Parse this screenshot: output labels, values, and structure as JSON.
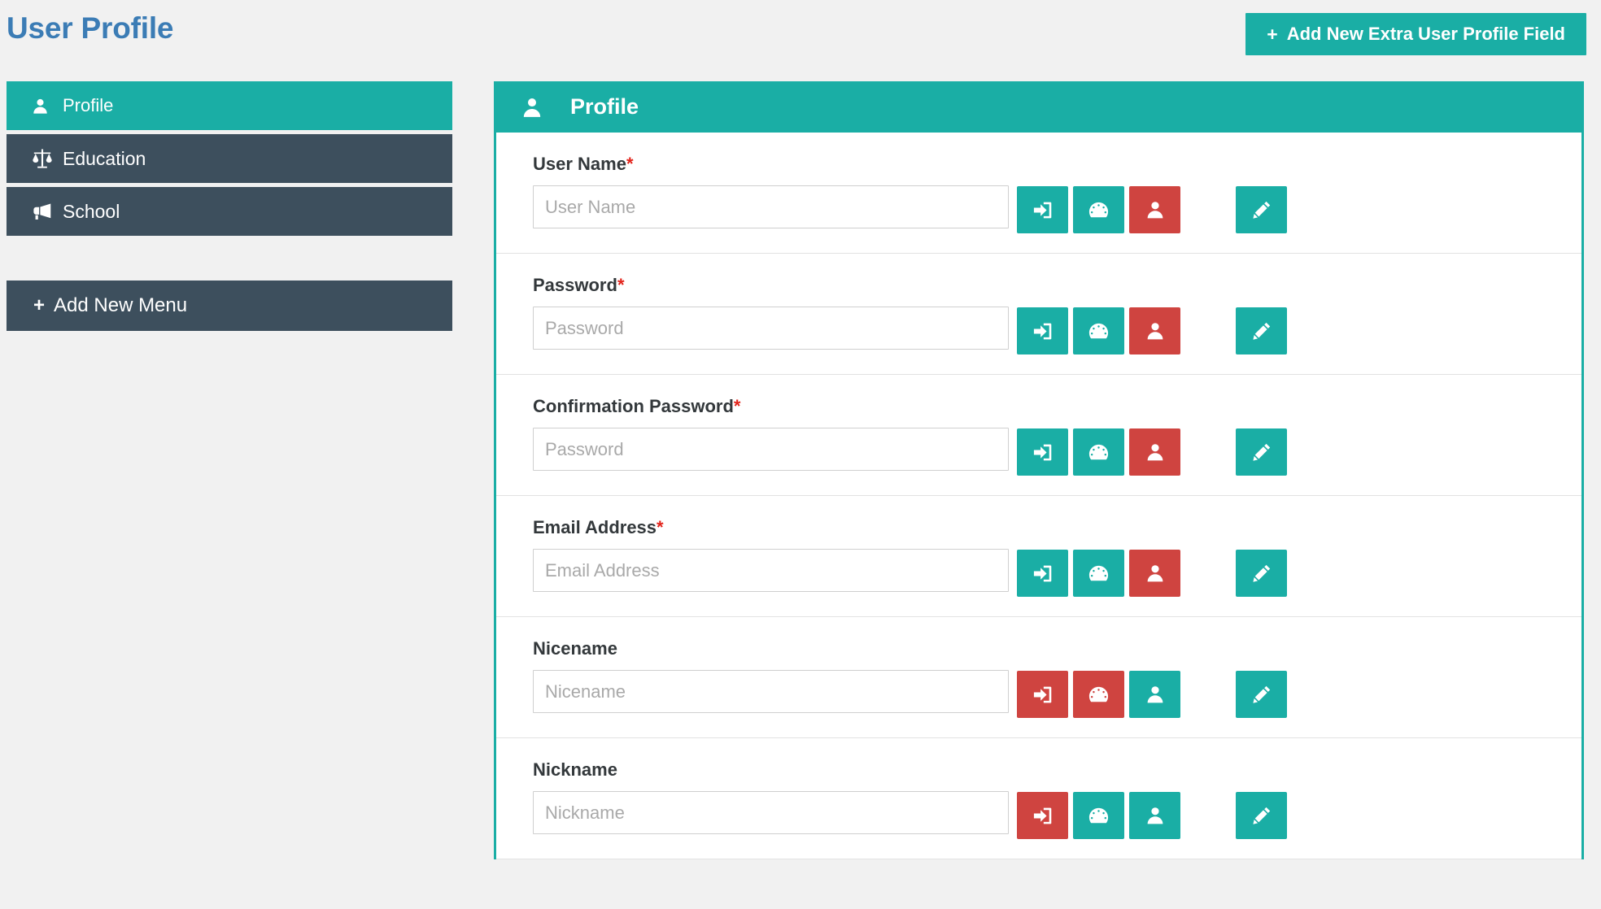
{
  "header": {
    "title": "User Profile",
    "add_field_button": "Add New Extra User Profile Field",
    "plus": "+"
  },
  "sidebar": {
    "items": [
      {
        "label": "Profile",
        "icon": "user-icon",
        "active": true
      },
      {
        "label": "Education",
        "icon": "balance-scale-icon",
        "active": false
      },
      {
        "label": "School",
        "icon": "bullhorn-icon",
        "active": false
      }
    ],
    "add_menu_button": "Add New Menu",
    "plus": "+"
  },
  "panel": {
    "title": "Profile",
    "icon": "user-icon",
    "rows": [
      {
        "label": "User Name",
        "required": true,
        "placeholder": "User Name",
        "value": "",
        "actions": [
          {
            "icon": "sign-in-icon",
            "color": "teal"
          },
          {
            "icon": "tachometer-icon",
            "color": "teal"
          },
          {
            "icon": "user-icon",
            "color": "red"
          }
        ],
        "edit": {
          "icon": "pencil-icon",
          "color": "teal"
        }
      },
      {
        "label": "Password",
        "required": true,
        "placeholder": "Password",
        "value": "",
        "actions": [
          {
            "icon": "sign-in-icon",
            "color": "teal"
          },
          {
            "icon": "tachometer-icon",
            "color": "teal"
          },
          {
            "icon": "user-icon",
            "color": "red"
          }
        ],
        "edit": {
          "icon": "pencil-icon",
          "color": "teal"
        }
      },
      {
        "label": "Confirmation Password",
        "required": true,
        "placeholder": "Password",
        "value": "",
        "actions": [
          {
            "icon": "sign-in-icon",
            "color": "teal"
          },
          {
            "icon": "tachometer-icon",
            "color": "teal"
          },
          {
            "icon": "user-icon",
            "color": "red"
          }
        ],
        "edit": {
          "icon": "pencil-icon",
          "color": "teal"
        }
      },
      {
        "label": "Email Address",
        "required": true,
        "placeholder": "Email Address",
        "value": "",
        "actions": [
          {
            "icon": "sign-in-icon",
            "color": "teal"
          },
          {
            "icon": "tachometer-icon",
            "color": "teal"
          },
          {
            "icon": "user-icon",
            "color": "red"
          }
        ],
        "edit": {
          "icon": "pencil-icon",
          "color": "teal"
        }
      },
      {
        "label": "Nicename",
        "required": false,
        "placeholder": "Nicename",
        "value": "",
        "actions": [
          {
            "icon": "sign-in-icon",
            "color": "red"
          },
          {
            "icon": "tachometer-icon",
            "color": "red"
          },
          {
            "icon": "user-icon",
            "color": "teal"
          }
        ],
        "edit": {
          "icon": "pencil-icon",
          "color": "teal"
        }
      },
      {
        "label": "Nickname",
        "required": false,
        "placeholder": "Nickname",
        "value": "",
        "actions": [
          {
            "icon": "sign-in-icon",
            "color": "red"
          },
          {
            "icon": "tachometer-icon",
            "color": "teal"
          },
          {
            "icon": "user-icon",
            "color": "teal"
          }
        ],
        "edit": {
          "icon": "pencil-icon",
          "color": "teal"
        }
      }
    ]
  },
  "colors": {
    "teal": "#1aaea5",
    "red": "#cf4440",
    "dark": "#3d4f5d",
    "title_blue": "#3b7cb5",
    "required_red": "#e2231a",
    "page_bg": "#f1f1f1"
  }
}
